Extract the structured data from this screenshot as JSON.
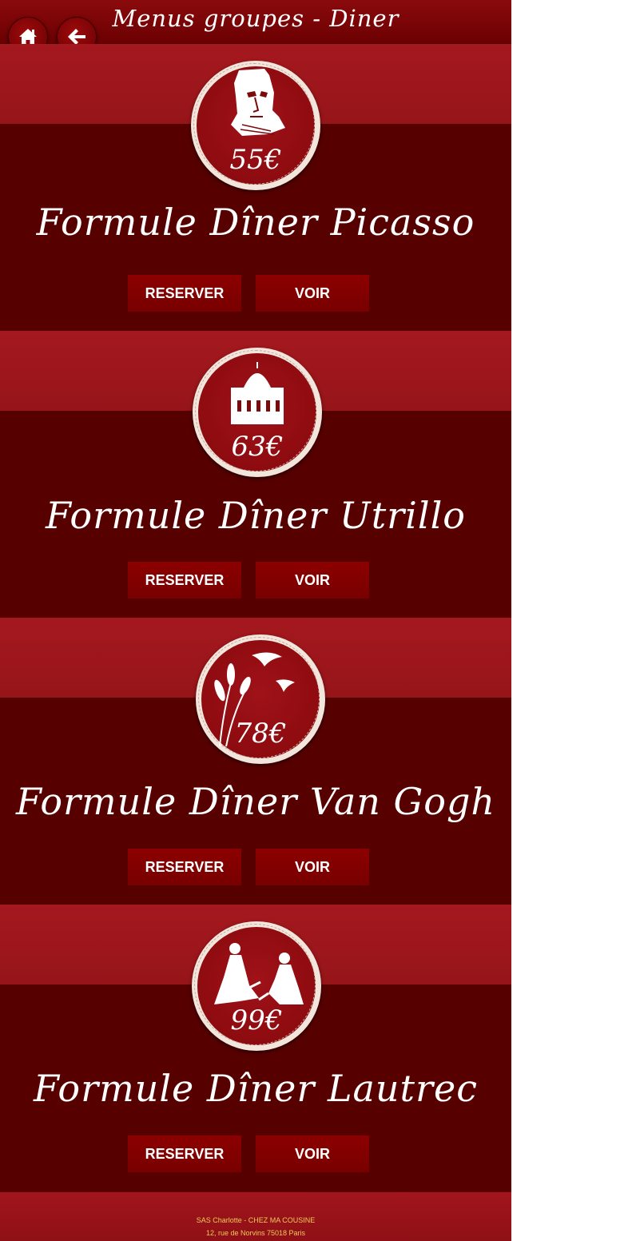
{
  "header": {
    "title": "Menus groupes - Diner",
    "home_icon": "home-icon",
    "back_icon": "arrow-left-icon"
  },
  "colors": {
    "band": "#a4181e",
    "section_bg": "#560000",
    "button_bg": "#8c0000",
    "footer_text": "#f0c85a"
  },
  "menus": [
    {
      "price": "55€",
      "title": "Formule Dîner Picasso",
      "illustration": "picasso-portrait-icon",
      "reserve_label": "RESERVER",
      "view_label": "VOIR"
    },
    {
      "price": "63€",
      "title": "Formule Dîner Utrillo",
      "illustration": "sacre-coeur-icon",
      "reserve_label": "RESERVER",
      "view_label": "VOIR"
    },
    {
      "price": "78€",
      "title": "Formule Dîner Van Gogh",
      "illustration": "wheat-and-birds-icon",
      "reserve_label": "RESERVER",
      "view_label": "VOIR"
    },
    {
      "price": "99€",
      "title": "Formule Dîner Lautrec",
      "illustration": "dancers-icon",
      "reserve_label": "RESERVER",
      "view_label": "VOIR"
    }
  ],
  "footer": {
    "line1": "SAS Charlotte - CHEZ MA COUSINE",
    "line2": "12, rue de Norvins 75018 Paris"
  }
}
